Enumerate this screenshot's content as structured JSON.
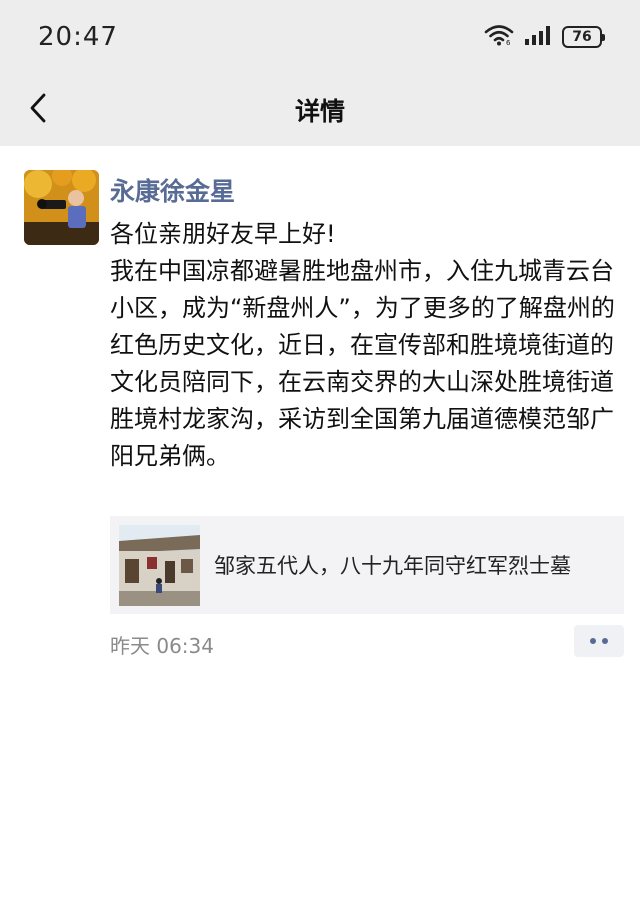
{
  "status_bar": {
    "time": "20:47",
    "battery": "76",
    "icons": [
      "wifi-icon",
      "signal-icon",
      "battery-icon"
    ]
  },
  "nav": {
    "title": "详情",
    "back_icon": "chevron-left-icon"
  },
  "post": {
    "author": "永康徐金星",
    "lines": [
      "各位亲朋好友早上好!",
      "我在中国凉都避暑胜地盘州市，入住九城青云台小区，成为“新盘州人”，为了更多的了解盘州的红色历史文化，近日，在宣传部和胜境境街道的文化员陪同下，在云南交界的大山深处胜境街道胜境村龙家沟，采访到全国第九届道德模范邹广阳兄弟俩。"
    ],
    "link_card": {
      "title": "邹家五代人，八十九年同守红军烈士墓"
    },
    "time": "昨天 06:34",
    "more_icon": "more-dots-icon"
  },
  "colors": {
    "header_bg": "#ededed",
    "author_name": "#576b95",
    "card_bg": "#f3f3f5",
    "timestamp": "#8a8a8a"
  }
}
